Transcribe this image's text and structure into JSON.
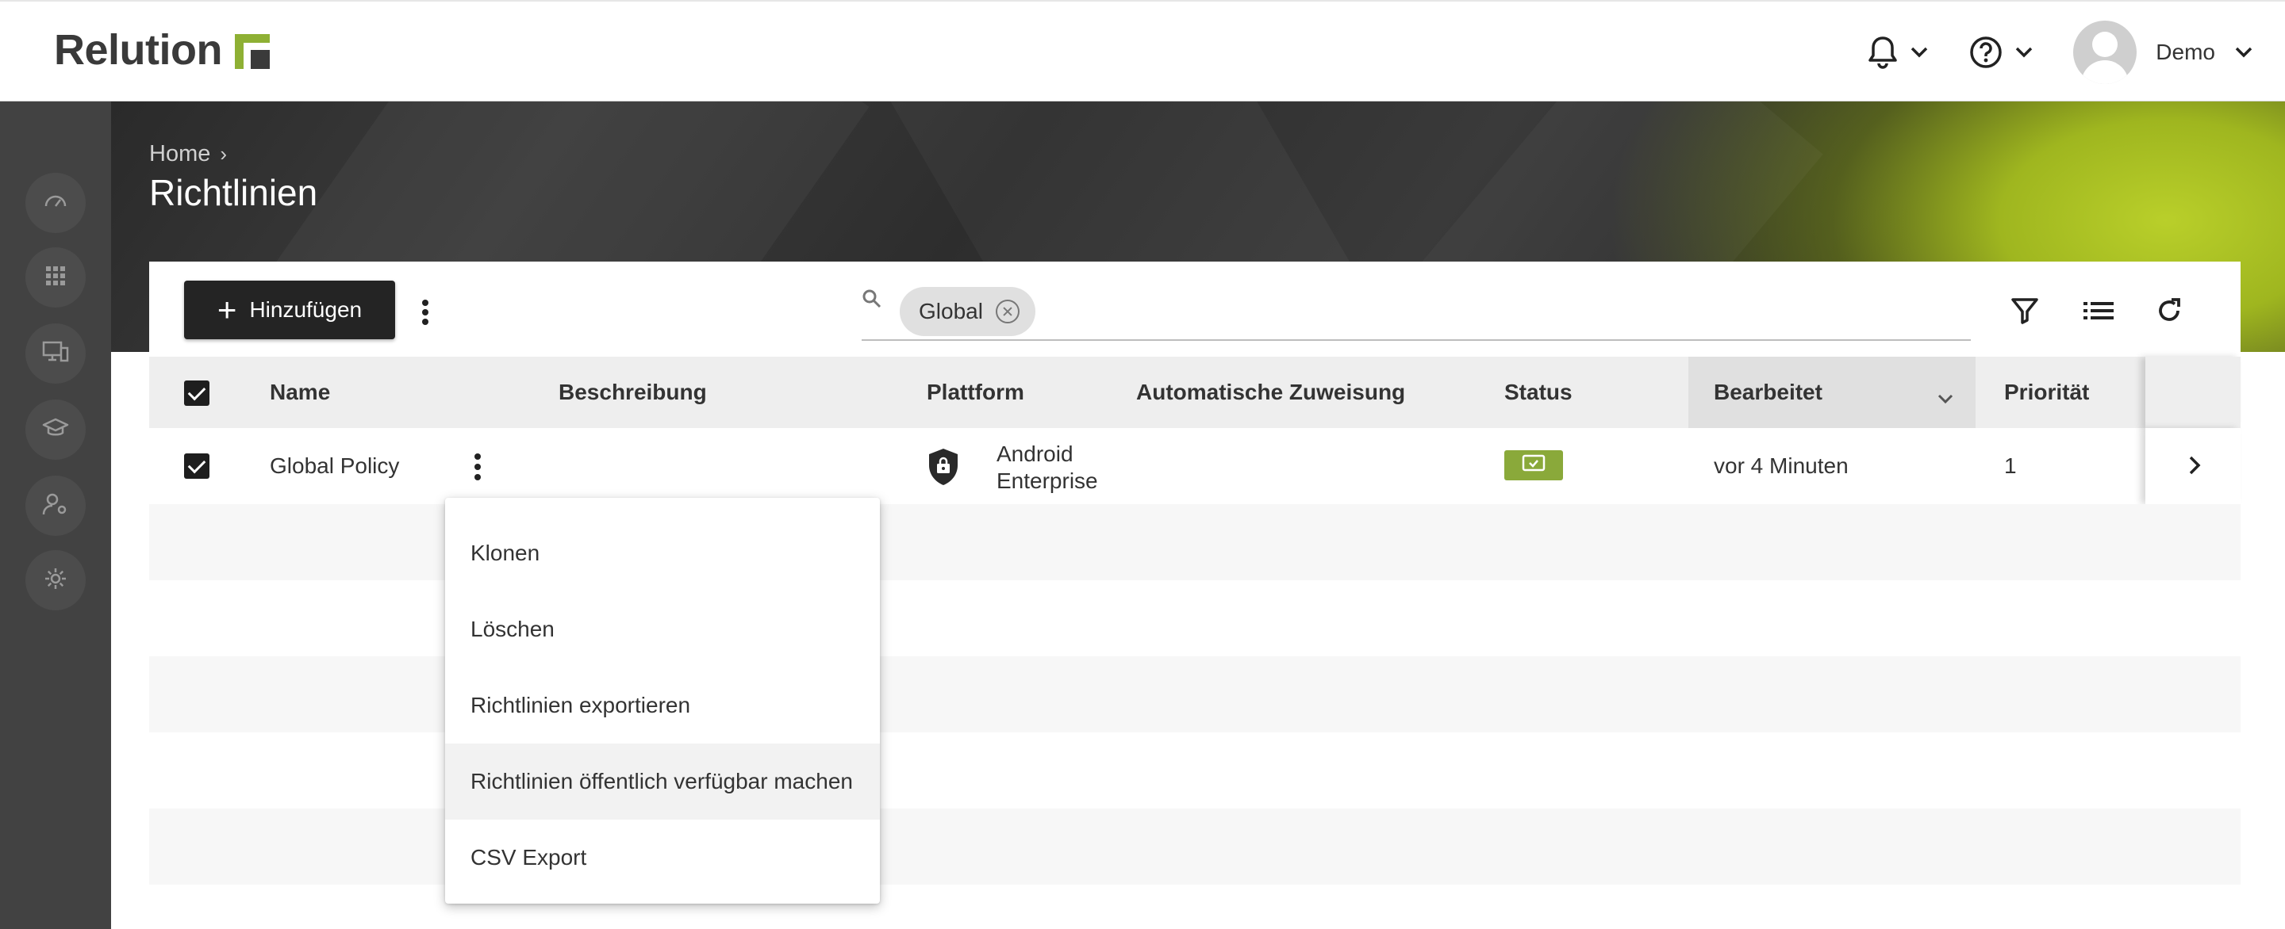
{
  "app": {
    "logo_text": "Relution"
  },
  "topbar": {
    "notifications_icon": "bell-icon",
    "help_icon": "question-circle-icon",
    "user_name": "Demo"
  },
  "sidebar": {
    "items": [
      {
        "icon": "dashboard-gauge-icon"
      },
      {
        "icon": "apps-grid-icon"
      },
      {
        "icon": "devices-icon"
      },
      {
        "icon": "education-cap-icon"
      },
      {
        "icon": "user-settings-icon"
      },
      {
        "icon": "settings-gear-icon"
      }
    ]
  },
  "header": {
    "breadcrumb": {
      "home": "Home",
      "separator": "›"
    },
    "title": "Richtlinien"
  },
  "toolbar": {
    "add_label": "Hinzufügen",
    "filter_chip": "Global"
  },
  "table": {
    "columns": [
      "Name",
      "Beschreibung",
      "Plattform",
      "Automatische Zuweisung",
      "Status",
      "Bearbeitet",
      "Priorität"
    ],
    "sorted_column": "Bearbeitet",
    "rows": [
      {
        "name": "Global Policy",
        "description": "",
        "platform_line1": "Android",
        "platform_line2": "Enterprise",
        "auto_assign": "",
        "status_icon": "device-check-icon",
        "edited": "vor 4 Minuten",
        "priority": "1"
      }
    ]
  },
  "context_menu": {
    "items": [
      "Klonen",
      "Löschen",
      "Richtlinien exportieren",
      "Richtlinien öffentlich verfügbar machen",
      "CSV Export"
    ],
    "hovered_index": 3
  },
  "colors": {
    "accent_green": "#8aa93a",
    "dark_button": "#242424",
    "sidebar": "#424242"
  }
}
